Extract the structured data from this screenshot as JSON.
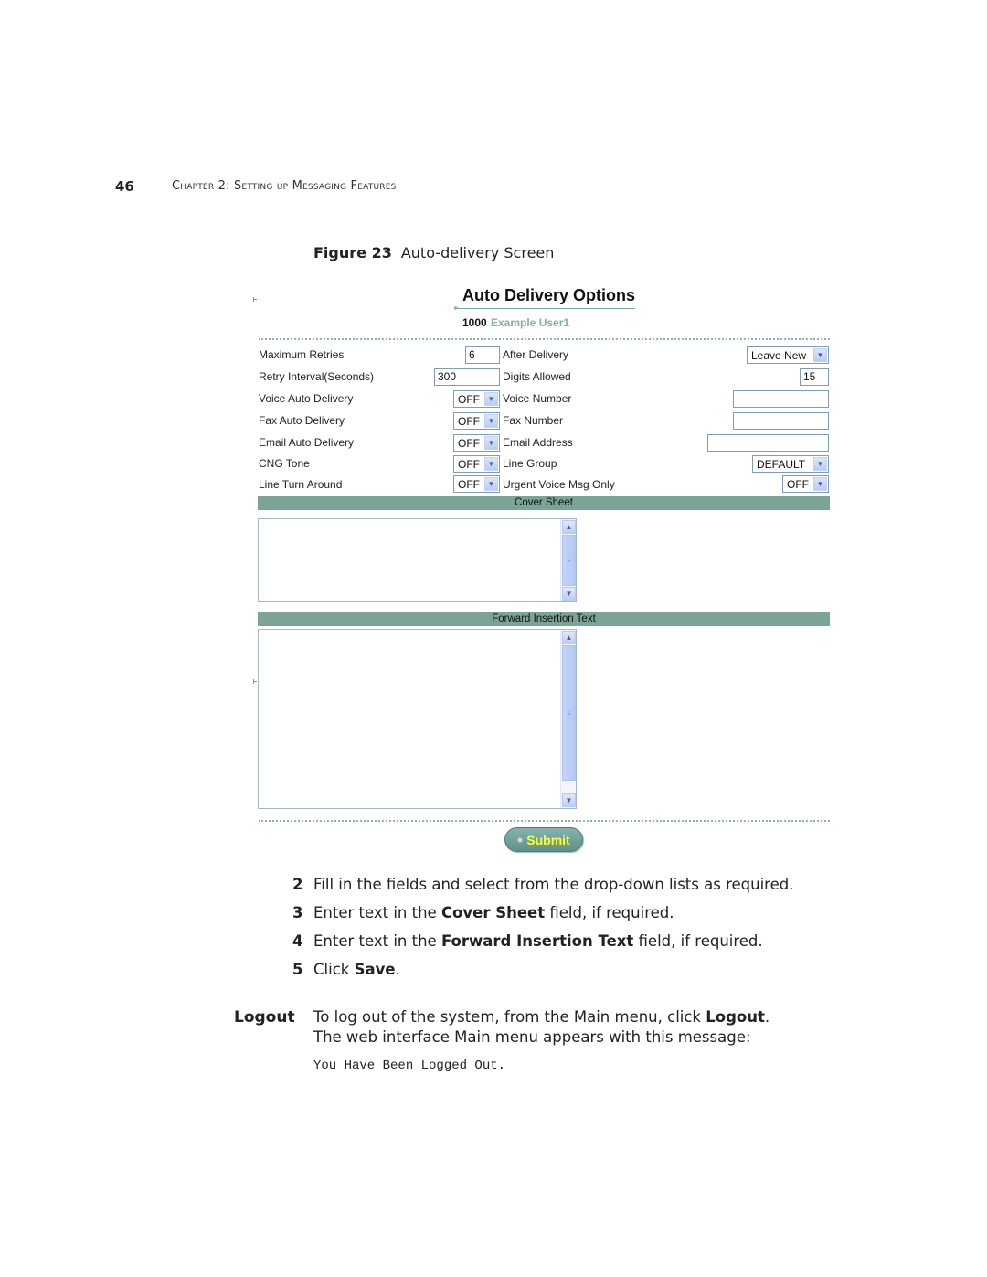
{
  "page_header": {
    "page_number": "46",
    "chapter": "Chapter 2: Setting up Messaging Features"
  },
  "figure": {
    "label": "Figure 23",
    "caption": "Auto-delivery Screen"
  },
  "screen": {
    "title": "Auto Delivery Options",
    "user_extension": "1000",
    "user_name": "Example User1",
    "left_fields": [
      {
        "label": "Maximum Retries",
        "type": "text",
        "value": "6"
      },
      {
        "label": "Retry Interval(Seconds)",
        "type": "text",
        "value": "300"
      },
      {
        "label": "Voice Auto Delivery",
        "type": "select",
        "value": "OFF"
      },
      {
        "label": "Fax Auto Delivery",
        "type": "select",
        "value": "OFF"
      },
      {
        "label": "Email Auto Delivery",
        "type": "select",
        "value": "OFF"
      },
      {
        "label": "CNG Tone",
        "type": "select",
        "value": "OFF"
      },
      {
        "label": "Line Turn Around",
        "type": "select",
        "value": "OFF"
      }
    ],
    "right_fields": [
      {
        "label": "After Delivery",
        "type": "select",
        "value": "Leave New"
      },
      {
        "label": "Digits Allowed",
        "type": "text",
        "value": "15"
      },
      {
        "label": "Voice Number",
        "type": "text",
        "value": ""
      },
      {
        "label": "Fax Number",
        "type": "text",
        "value": ""
      },
      {
        "label": "Email Address",
        "type": "text",
        "value": ""
      },
      {
        "label": "Line Group",
        "type": "select",
        "value": "DEFAULT"
      },
      {
        "label": "Urgent Voice Msg Only",
        "type": "select",
        "value": "OFF"
      }
    ],
    "cover_sheet_header": "Cover Sheet",
    "cover_sheet_value": "",
    "forward_insertion_header": "Forward Insertion Text",
    "forward_insertion_value": "",
    "submit_label": "Submit",
    "icons": {
      "dropdown_arrow": "chevron-down",
      "scroll_up": "chevron-up",
      "scroll_down": "chevron-down",
      "thumb_grip": "grip-lines"
    },
    "colors": {
      "section_band": "#7aa595",
      "user_name": "#7fb0a6",
      "submit_text": "#ffff33",
      "submit_bg": "#6f a39d"
    }
  },
  "steps": [
    {
      "num": "2",
      "parts": [
        {
          "t": "Fill in the fields and select from the drop-down lists as required.",
          "b": false
        }
      ]
    },
    {
      "num": "3",
      "parts": [
        {
          "t": "Enter text in the ",
          "b": false
        },
        {
          "t": "Cover Sheet",
          "b": true
        },
        {
          "t": " field, if required.",
          "b": false
        }
      ]
    },
    {
      "num": "4",
      "parts": [
        {
          "t": "Enter text in the ",
          "b": false
        },
        {
          "t": "Forward Insertion Text",
          "b": true
        },
        {
          "t": " field, if required.",
          "b": false
        }
      ]
    },
    {
      "num": "5",
      "parts": [
        {
          "t": "Click ",
          "b": false
        },
        {
          "t": "Save",
          "b": true
        },
        {
          "t": ".",
          "b": false
        }
      ]
    }
  ],
  "logout": {
    "heading": "Logout",
    "line1_pre": "To log out of the system, from the Main menu, click ",
    "line1_bold": "Logout",
    "line1_post": ".",
    "line2": "The web interface Main menu appears with this message:",
    "message": "You Have Been Logged Out."
  }
}
